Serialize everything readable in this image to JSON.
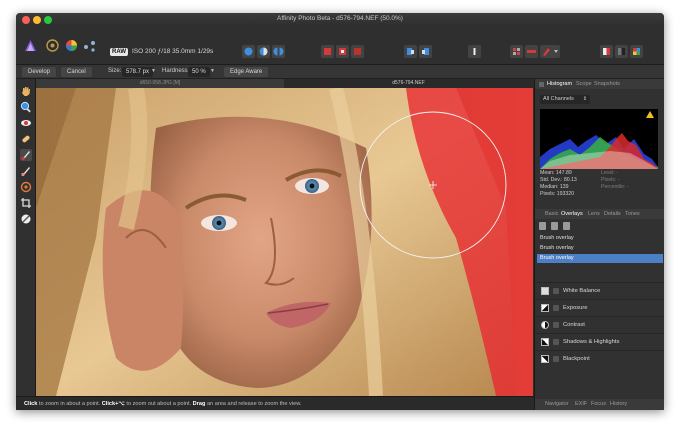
{
  "window": {
    "title": "Affinity Photo Beta - d576-794.NEF (50.0%)"
  },
  "toolbar": {
    "raw_badge": "RAW",
    "camera_info": "ISO 200 ƒ/18 35.0mm 1/29s"
  },
  "context": {
    "develop": "Develop",
    "cancel": "Cancel",
    "size_label": "Size:",
    "size_value": "578.7 px",
    "hardness_label": "Hardness:",
    "hardness_value": "50 %",
    "edge_aware": "Edge Aware"
  },
  "tabs": [
    {
      "label": "d650-058.JPG [M]"
    },
    {
      "label": "d576-794.NEF"
    }
  ],
  "panel": {
    "top_tabs": [
      "Histogram",
      "Scope",
      "Snapshots"
    ],
    "channel": "All Channels",
    "stats": {
      "mean": "Mean: 147.89",
      "std_dev": "Std. Dev.: 80.13",
      "median": "Median: 139",
      "pixels": "Pixels: 193320",
      "level": "Level: -",
      "pixel": "Pixels: -",
      "percentile": "Percentile: -"
    },
    "mid_tabs": [
      "Basic",
      "Overlays",
      "Lens",
      "Details",
      "Tones"
    ],
    "overlays": [
      "Brush overlay",
      "Brush overlay",
      "Brush overlay"
    ],
    "adjustments": [
      "White Balance",
      "Exposure",
      "Contrast",
      "Shadows & Highlights",
      "Blackpoint"
    ],
    "bottom_tabs": [
      "Navigator",
      "EXIF",
      "Focus",
      "History"
    ]
  },
  "status": {
    "click": "Click",
    "t1": " to zoom in about a point. ",
    "click2": "Click+⌥",
    "t2": " to zoom out about a point. ",
    "drag": "Drag",
    "t3": " an area and release to zoom the view."
  },
  "colors": {
    "accent": "#4d7fc6",
    "overlay_red": "#e8282f"
  }
}
